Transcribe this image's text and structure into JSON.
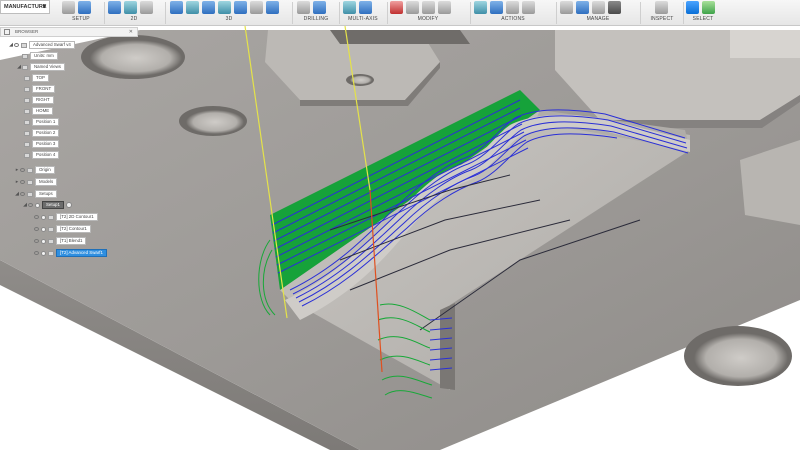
{
  "toolbar": {
    "workspace": "MANUFACTURE",
    "groups": [
      {
        "label": "SETUP"
      },
      {
        "label": "2D"
      },
      {
        "label": "3D"
      },
      {
        "label": "DRILLING"
      },
      {
        "label": "MULTI-AXIS"
      },
      {
        "label": "MODIFY"
      },
      {
        "label": "ACTIONS"
      },
      {
        "label": "MANAGE"
      },
      {
        "label": "INSPECT"
      },
      {
        "label": "SELECT"
      }
    ]
  },
  "browser": {
    "title": "BROWSER",
    "root": "Advanced Swarf v4",
    "units": "Units: mm",
    "named_views": "Named Views",
    "views": [
      "TOP",
      "FRONT",
      "RIGHT",
      "HOME",
      "Position 1",
      "Position 2",
      "Position 3",
      "Position 4"
    ],
    "origin": "Origin",
    "models": "Models",
    "setups": "Setups",
    "setup": "Setup1",
    "operations": [
      "[T2] 2D Contour1",
      "[T2] Contour1",
      "[T1] Blend1",
      "[T2] Advanced Swarf1"
    ]
  },
  "colors": {
    "accent": "#2f8fe0",
    "part_steel": "#9a9794",
    "toolpath_blue": "#2a2fd6",
    "toolpath_green": "#18a838",
    "tool_axis_yellow": "#e4e24a",
    "tool_axis_red": "#e0501f"
  }
}
